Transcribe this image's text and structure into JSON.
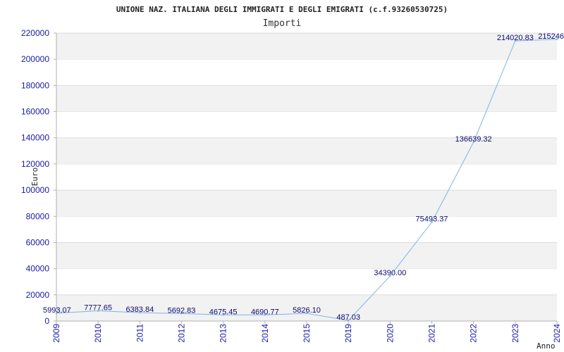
{
  "chart_data": {
    "type": "line",
    "title": "UNIONE NAZ. ITALIANA DEGLI IMMIGRATI E DEGLI EMIGRATI (c.f.93260530725)",
    "subtitle": "Importi",
    "xlabel": "Anno",
    "ylabel": "Euro",
    "ylim": [
      0,
      220000
    ],
    "yticks": [
      "0",
      "20000",
      "40000",
      "60000",
      "80000",
      "100000",
      "120000",
      "140000",
      "160000",
      "180000",
      "200000",
      "220000"
    ],
    "categories": [
      "2009",
      "2010",
      "2011",
      "2012",
      "2013",
      "2014",
      "2015",
      "2019",
      "2020",
      "2021",
      "2022",
      "2023",
      "2024"
    ],
    "values": [
      5993.07,
      7777.65,
      6383.84,
      5692.83,
      4675.45,
      4690.77,
      5826.1,
      487.03,
      34390.0,
      75493.37,
      136639.32,
      214020.83,
      215246
    ],
    "value_labels": [
      "5993.07",
      "7777.65",
      "6383.84",
      "5692.83",
      "4675.45",
      "4690.77",
      "5826.10",
      "487.03",
      "34390.00",
      "75493.37",
      "136639.32",
      "214020.83",
      "215246"
    ],
    "grid": "horizontal bands",
    "colors": {
      "line": "#7db4e8",
      "band": "#f2f2f2",
      "tick_text": "#1a1aa6",
      "label_text": "#0a0a70"
    }
  }
}
